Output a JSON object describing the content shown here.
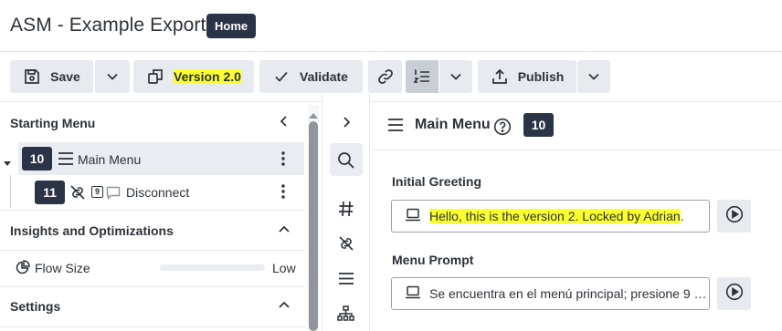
{
  "app": {
    "title": "ASM - Example Export",
    "home_badge": "Home"
  },
  "toolbar": {
    "save_label": "Save",
    "version_label": "Version 2.0",
    "validate_label": "Validate",
    "publish_label": "Publish"
  },
  "left_panel": {
    "starting_menu_title": "Starting Menu",
    "tree": [
      {
        "number": "10",
        "label": "Main Menu",
        "icon": "menu-lines-icon"
      },
      {
        "number": "11",
        "label": "Disconnect",
        "icon": "unlink-icon",
        "small_badge": "9"
      }
    ],
    "insights_title": "Insights and Optimizations",
    "flow_size_label": "Flow Size",
    "flow_size_value": "Low",
    "flow_size_fraction": 0.0,
    "settings_title": "Settings"
  },
  "icon_strip": [
    "chevron-right-icon",
    "search-icon",
    "hash-icon",
    "unlink-icon",
    "list-icon",
    "sitemap-icon"
  ],
  "right_panel": {
    "title": "Main Menu",
    "badge": "10",
    "fields": [
      {
        "label": "Initial Greeting",
        "value": "Hello, this is the version 2. Locked by Adrian",
        "suffix": "."
      },
      {
        "label": "Menu Prompt",
        "value": "Se encuentra en el menú principal; presione 9 p..."
      }
    ]
  },
  "colors": {
    "accent_dark": "#2b3446",
    "highlight": "#fbff2a",
    "button_bg": "#e7eaee"
  }
}
